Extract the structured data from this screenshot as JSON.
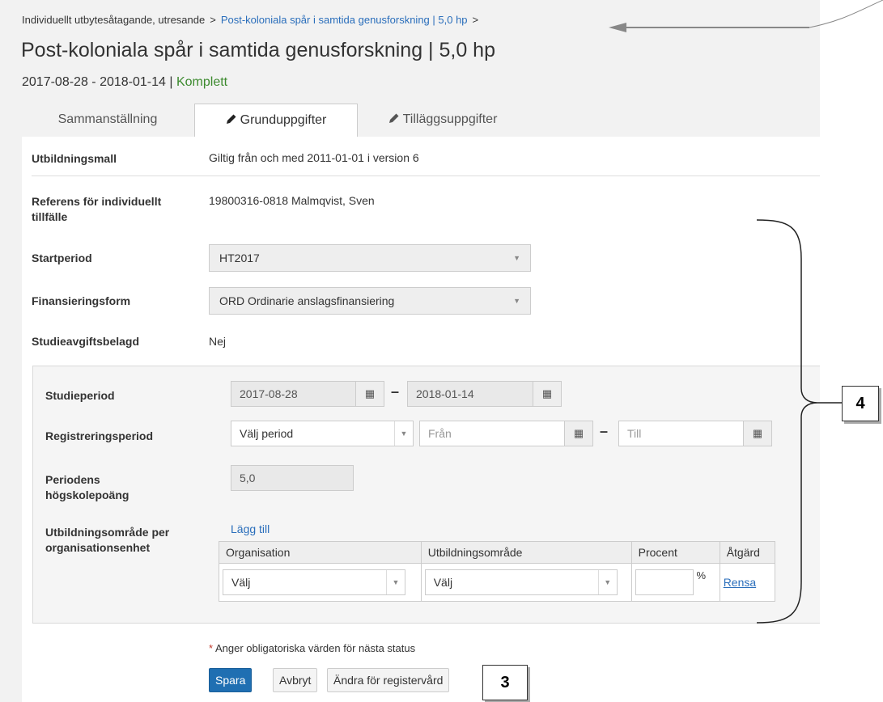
{
  "breadcrumb": {
    "parent": "Individuellt utbytesåtagande, utresande",
    "current": "Post-koloniala spår i samtida genusforskning | 5,0 hp",
    "sep1": ">",
    "sep2": ">"
  },
  "page": {
    "title": "Post-koloniala spår i samtida genusforskning | 5,0 hp",
    "dates": "2017-08-28 - 2018-01-14 |",
    "status": "Komplett"
  },
  "tabs": [
    {
      "label": "Sammanställning",
      "icon": ""
    },
    {
      "label": "Grunduppgifter",
      "icon": "pencil-icon"
    },
    {
      "label": "Tilläggsuppgifter",
      "icon": "pencil-icon"
    }
  ],
  "form": {
    "utbildningsmall": {
      "label": "Utbildningsmall",
      "value": "Giltig från och med 2011-01-01 i version 6"
    },
    "referens": {
      "label": "Referens för individuellt tillfälle",
      "value": "19800316-0818 Malmqvist, Sven"
    },
    "startperiod": {
      "label": "Startperiod",
      "value": "HT2017"
    },
    "finansieringsform": {
      "label": "Finansieringsform",
      "value": "ORD Ordinarie anslagsfinansiering"
    },
    "studieavgift": {
      "label": "Studieavgiftsbelagd",
      "value": "Nej"
    },
    "studieperiod": {
      "label": "Studieperiod",
      "from": "2017-08-28",
      "to": "2018-01-14"
    },
    "registreringsperiod": {
      "label": "Registreringsperiod",
      "select": "Välj period",
      "from_placeholder": "Från",
      "to_placeholder": "Till"
    },
    "periodens_hp": {
      "label": "Periodens högskolepoäng",
      "value": "5,0"
    },
    "utbildningsomrade": {
      "label": "Utbildningsområde per organisationsenhet",
      "add_link": "Lägg till",
      "columns": [
        "Organisation",
        "Utbildningsområde",
        "Procent",
        "Åtgärd"
      ],
      "row": {
        "organisation": "Välj",
        "omrade": "Välj",
        "percent_sign": "%",
        "action": "Rensa"
      }
    }
  },
  "footer": {
    "required_star": "*",
    "required_note": "Anger obligatoriska värden för nästa status",
    "buttons": {
      "save": "Spara",
      "cancel": "Avbryt",
      "change": "Ändra för registervård"
    }
  },
  "callouts": {
    "three": "3",
    "four": "4"
  },
  "colors": {
    "link": "#2a6ebb",
    "primary": "#1f6fb2",
    "status_green": "#3c8a2e"
  }
}
